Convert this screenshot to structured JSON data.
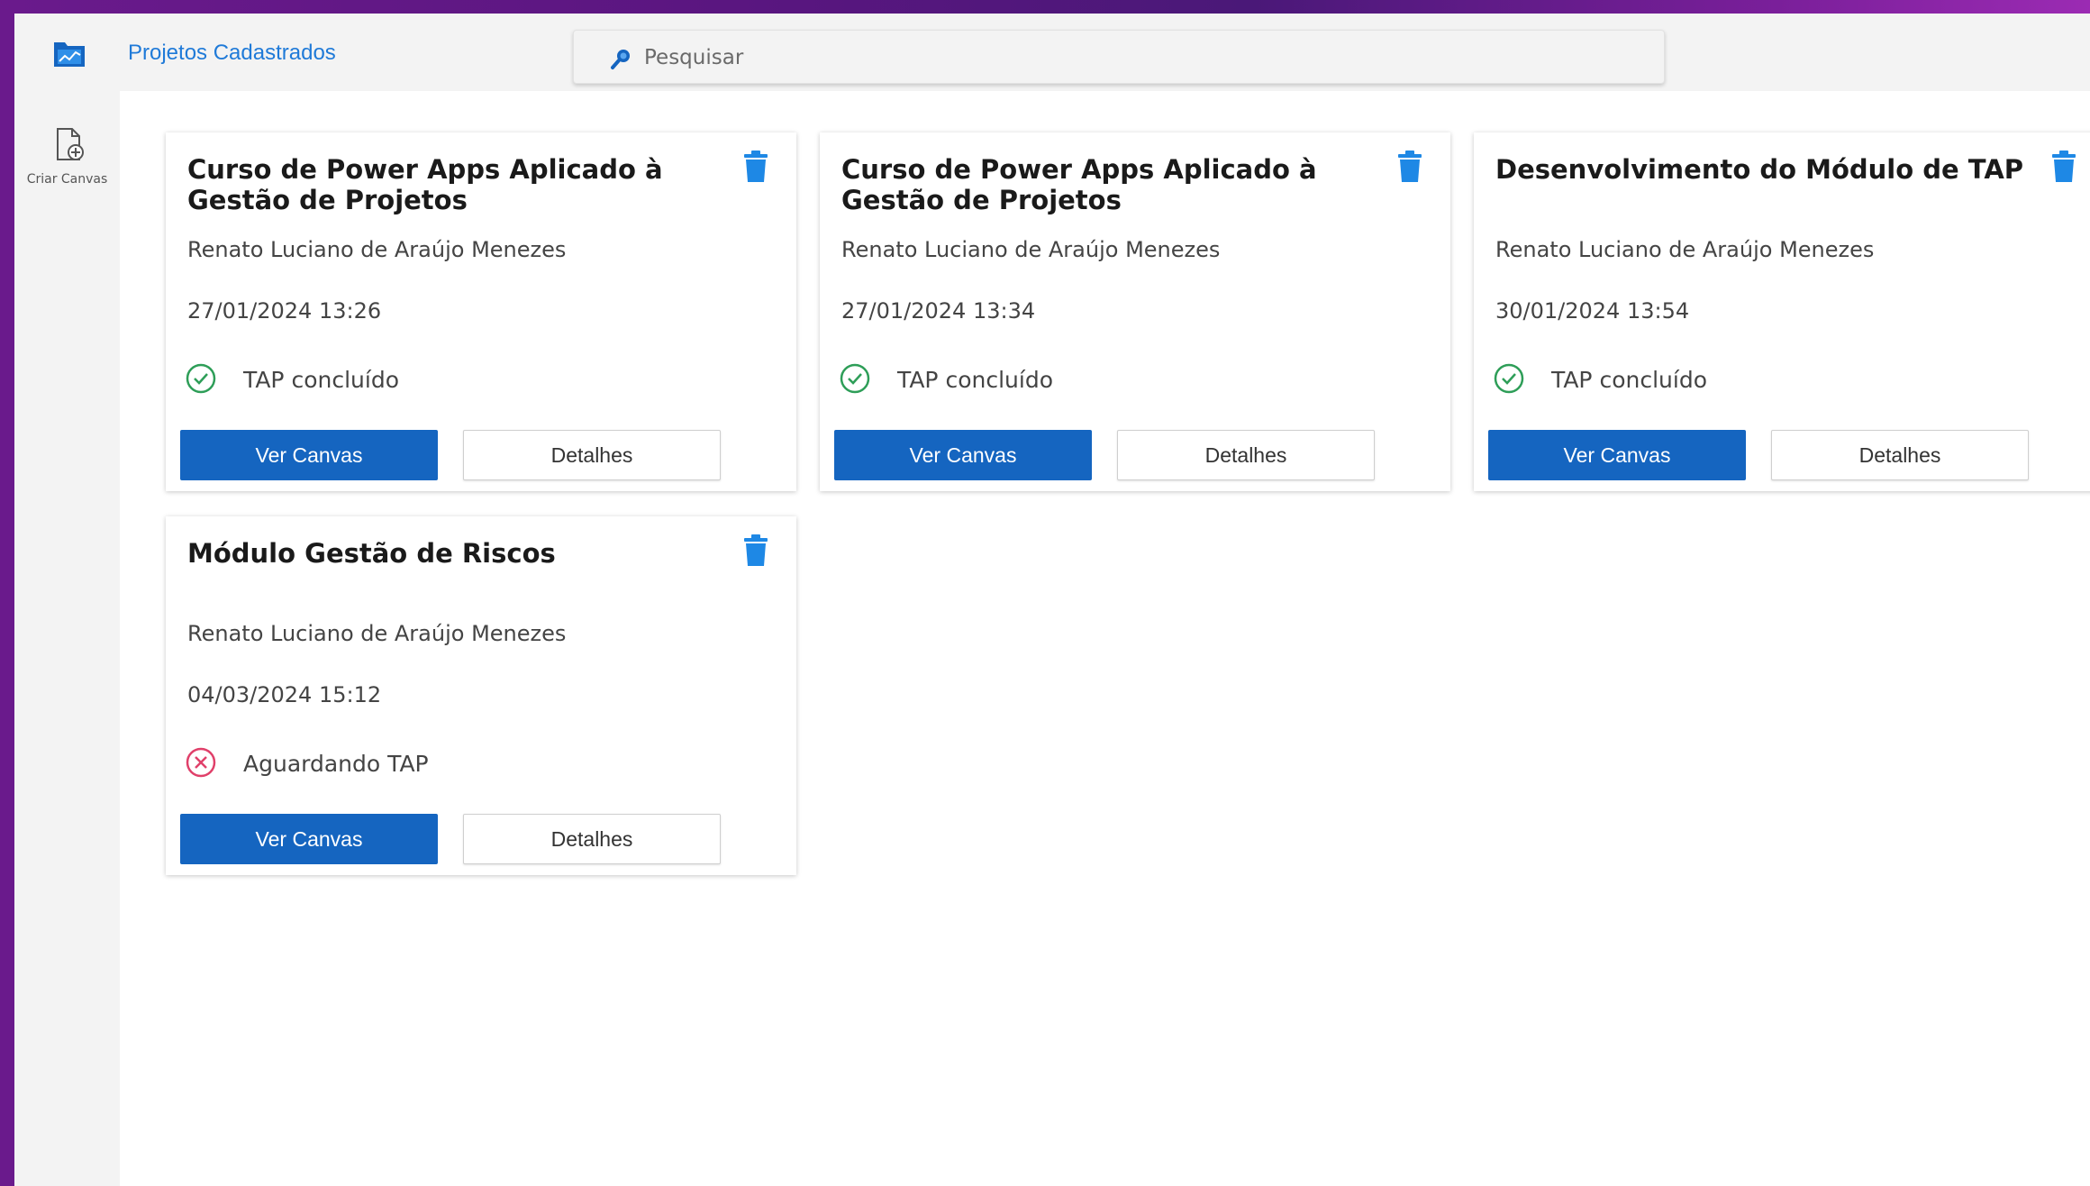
{
  "header": {
    "title": "Projetos Cadastrados",
    "search_placeholder": "Pesquisar",
    "app_icon": "folder-chart-icon",
    "search_icon": "search-icon"
  },
  "sidebar": {
    "create_canvas_label": "Criar Canvas",
    "create_canvas_icon": "add-document-icon"
  },
  "colors": {
    "primary": "#1565c0",
    "title_link": "#1f7ad8",
    "trash": "#1e88e5",
    "status_ok": "#2e9e58",
    "status_pending": "#e0406a"
  },
  "cards": [
    {
      "title": "Curso de Power Apps Aplicado à Gestão de Projetos",
      "author": "Renato Luciano de Araújo Menezes",
      "date": "27/01/2024 13:26",
      "status": "TAP concluído",
      "status_type": "done",
      "primary_label": "Ver Canvas",
      "secondary_label": "Detalhes"
    },
    {
      "title": "Curso de Power Apps Aplicado à Gestão de Projetos",
      "author": "Renato Luciano de Araújo Menezes",
      "date": "27/01/2024 13:34",
      "status": "TAP concluído",
      "status_type": "done",
      "primary_label": "Ver Canvas",
      "secondary_label": "Detalhes"
    },
    {
      "title": "Desenvolvimento do Módulo de TAP",
      "author": "Renato Luciano de Araújo Menezes",
      "date": "30/01/2024 13:54",
      "status": "TAP concluído",
      "status_type": "done",
      "primary_label": "Ver Canvas",
      "secondary_label": "Detalhes"
    },
    {
      "title": "Módulo Gestão de Riscos",
      "author": "Renato Luciano de Araújo Menezes",
      "date": "04/03/2024 15:12",
      "status": "Aguardando TAP",
      "status_type": "pending",
      "primary_label": "Ver Canvas",
      "secondary_label": "Detalhes"
    }
  ]
}
